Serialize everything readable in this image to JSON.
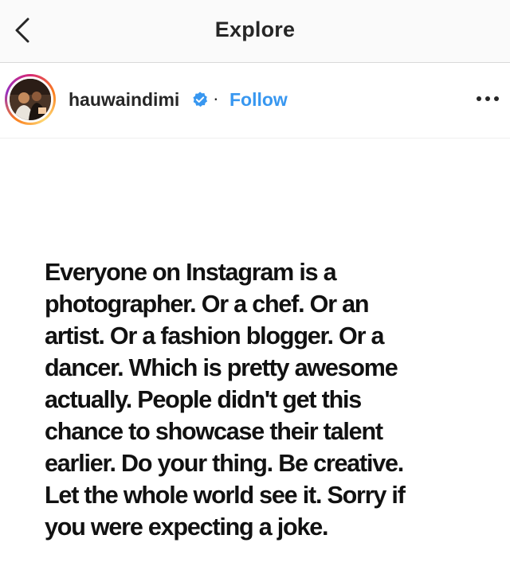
{
  "navbar": {
    "title": "Explore",
    "back_icon": "chevron-left-icon"
  },
  "post": {
    "username": "hauwaindimi",
    "verified": true,
    "separator": "·",
    "follow_label": "Follow",
    "more_icon": "more-horizontal-icon",
    "image_text_lines": [
      "Everyone on Instagram is a",
      "photographer. Or a chef. Or an",
      "artist. Or a fashion blogger. Or a",
      "dancer. Which is pretty awesome",
      "actually. People didn't get this",
      "chance to showcase their talent",
      "earlier. Do your thing. Be creative.",
      "Let the whole world see it. Sorry if",
      "you were expecting a joke."
    ]
  },
  "colors": {
    "accent": "#3897f0",
    "text": "#262626",
    "navbar_bg": "#fafafa"
  }
}
